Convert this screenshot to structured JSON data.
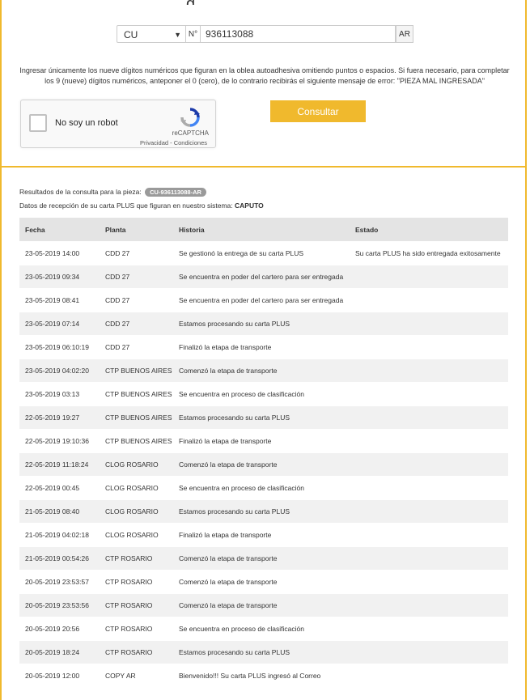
{
  "form": {
    "type_value": "CU",
    "number_prefix": "N°",
    "number_value": "936113088",
    "country_suffix": "AR",
    "instructions": "Ingresar únicamente los nueve dígitos numéricos que figuran en la oblea autoadhesiva omitiendo puntos o espacios. Si fuera necesario, para completar los 9 (nueve) dígitos numéricos, anteponer el 0 (cero), de lo contrario recibirás el siguiente mensaje de error: \"PIEZA MAL INGRESADA\"",
    "consultar_label": "Consultar"
  },
  "captcha": {
    "label": "No soy un robot",
    "brand": "reCAPTCHA",
    "links": "Privacidad - Condiciones"
  },
  "result": {
    "line1_prefix": "Resultados de la consulta para la pieza:",
    "piece_id": "CU-936113088-AR",
    "line2_prefix": "Datos de recepción de su carta PLUS que figuran en nuestro sistema:",
    "recipient": "CAPUTO"
  },
  "table": {
    "headers": [
      "Fecha",
      "Planta",
      "Historia",
      "Estado"
    ],
    "rows": [
      [
        "23-05-2019 14:00",
        "CDD 27",
        "Se gestionó la entrega de su carta PLUS",
        "Su carta PLUS ha sido entregada exitosamente"
      ],
      [
        "23-05-2019 09:34",
        "CDD 27",
        "Se encuentra en poder del cartero para ser entregada",
        ""
      ],
      [
        "23-05-2019 08:41",
        "CDD 27",
        "Se encuentra en poder del cartero para ser entregada",
        ""
      ],
      [
        "23-05-2019 07:14",
        "CDD 27",
        "Estamos procesando su carta PLUS",
        ""
      ],
      [
        "23-05-2019 06:10:19",
        "CDD 27",
        "Finalizó la etapa de transporte",
        ""
      ],
      [
        "23-05-2019 04:02:20",
        "CTP BUENOS AIRES",
        "Comenzó la etapa de transporte",
        ""
      ],
      [
        "23-05-2019 03:13",
        "CTP BUENOS AIRES",
        "Se encuentra en proceso de clasificación",
        ""
      ],
      [
        "22-05-2019 19:27",
        "CTP BUENOS AIRES",
        "Estamos procesando su carta PLUS",
        ""
      ],
      [
        "22-05-2019 19:10:36",
        "CTP BUENOS AIRES",
        "Finalizó la etapa de transporte",
        ""
      ],
      [
        "22-05-2019 11:18:24",
        "CLOG ROSARIO",
        "Comenzó la etapa de transporte",
        ""
      ],
      [
        "22-05-2019 00:45",
        "CLOG ROSARIO",
        "Se encuentra en proceso de clasificación",
        ""
      ],
      [
        "21-05-2019 08:40",
        "CLOG ROSARIO",
        "Estamos procesando su carta PLUS",
        ""
      ],
      [
        "21-05-2019 04:02:18",
        "CLOG ROSARIO",
        "Finalizó la etapa de transporte",
        ""
      ],
      [
        "21-05-2019 00:54:26",
        "CTP ROSARIO",
        "Comenzó la etapa de transporte",
        ""
      ],
      [
        "20-05-2019 23:53:57",
        "CTP ROSARIO",
        "Comenzó la etapa de transporte",
        ""
      ],
      [
        "20-05-2019 23:53:56",
        "CTP ROSARIO",
        "Comenzó la etapa de transporte",
        ""
      ],
      [
        "20-05-2019 20:56",
        "CTP ROSARIO",
        "Se encuentra en proceso de clasificación",
        ""
      ],
      [
        "20-05-2019 18:24",
        "CTP ROSARIO",
        "Estamos procesando su carta PLUS",
        ""
      ],
      [
        "20-05-2019 12:00",
        "COPY AR",
        "Bienvenido!!! Su carta PLUS ingresó al Correo",
        ""
      ]
    ]
  },
  "colors": {
    "accent": "#f0b92d",
    "header_bg": "#e4e4e4",
    "row_alt_bg": "#f1f1f1",
    "pill_bg": "#9a9a9a"
  },
  "icons": {
    "select_arrow": "chevron-down-icon",
    "captcha_logo": "recaptcha-icon"
  }
}
